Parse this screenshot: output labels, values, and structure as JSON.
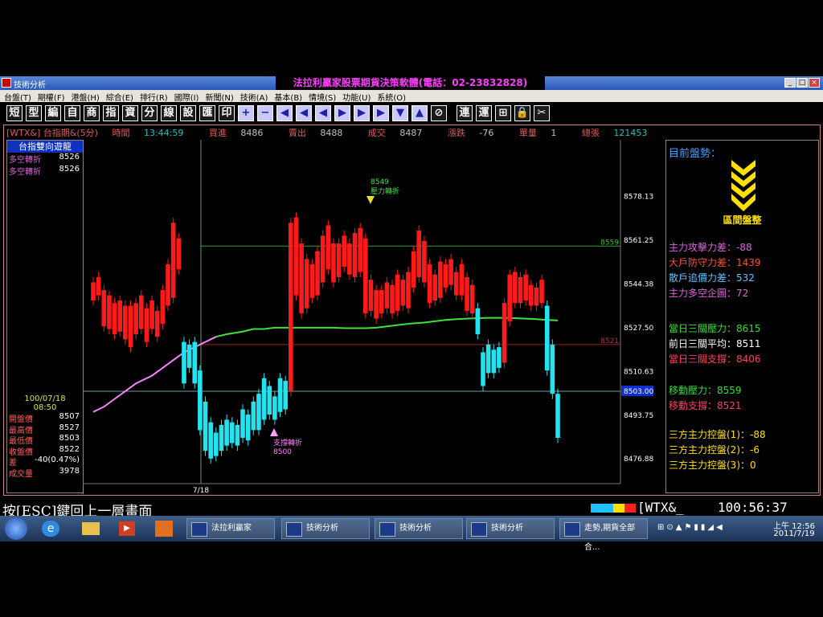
{
  "window": {
    "title": "技術分析",
    "center_title": "法拉利贏家股票期貨決策軟體(電話：02-23832828)"
  },
  "menu": [
    "台盤(T)",
    "期權(F)",
    "港盤(H)",
    "綜合(E)",
    "排行(R)",
    "國際(I)",
    "新聞(N)",
    "技術(A)",
    "基本(B)",
    "情境(S)",
    "功能(U)",
    "系統(O)"
  ],
  "toolbar": [
    "短",
    "型",
    "編",
    "自",
    "商",
    "指",
    "資",
    "分",
    "線",
    "設",
    "匯",
    "印",
    "+",
    "−",
    "◀",
    "◀",
    "◀",
    "▶",
    "▶",
    "▶",
    "▼",
    "▲",
    "⊘",
    "連",
    "運",
    "⊞",
    "🔒",
    "✂"
  ],
  "infobar": {
    "symbol": "[WTX&] 台指期&(5分)",
    "time_label": "時間",
    "time": "13:44:59",
    "bid_label": "買進",
    "bid": "8486",
    "ask_label": "賣出",
    "ask": "8488",
    "deal_label": "成交",
    "deal": "8487",
    "change_label": "漲跌",
    "change": "-76",
    "volume_label": "單量",
    "volume": "1",
    "total_label": "總張",
    "total": "121453"
  },
  "left_panel": {
    "header": "台指雙向遊龍",
    "rows": [
      {
        "label": "多空轉折",
        "value": "8526"
      },
      {
        "label": "多空轉折",
        "value": "8526"
      }
    ],
    "date": "100/07/18",
    "time": "08:50",
    "stats": [
      {
        "label": "開盤價",
        "value": "8507"
      },
      {
        "label": "最高價",
        "value": "8527"
      },
      {
        "label": "最低價",
        "value": "8503"
      },
      {
        "label": "收盤價",
        "value": "8522"
      },
      {
        "label": "差",
        "value": "-40(0.47%)"
      },
      {
        "label": "成交量",
        "value": "3978"
      }
    ]
  },
  "chart_data": {
    "type": "candlestick",
    "y_ticks": [
      "8578.13",
      "8561.25",
      "8544.38",
      "8527.50",
      "8510.63",
      "8503.00",
      "8493.75",
      "8476.88"
    ],
    "ylim": [
      8463,
      8600
    ],
    "x_tick": "7/18",
    "resistance_label": "8559",
    "support_label": "8521",
    "current_price": "8503.00",
    "annotations": [
      {
        "value": "8549",
        "text": "壓力轉折"
      },
      {
        "value": "8500",
        "text": "支撐轉折"
      }
    ],
    "candles": [
      [
        8543,
        8545,
        8540,
        8538
      ],
      [
        8544,
        8547,
        8540,
        8542
      ],
      [
        8542,
        8540,
        8530,
        8528
      ],
      [
        8538,
        8540,
        8528,
        8527
      ],
      [
        8535,
        8537,
        8526,
        8525
      ],
      [
        8536,
        8538,
        8527,
        8526
      ],
      [
        8533,
        8536,
        8524,
        8523
      ],
      [
        8531,
        8536,
        8521,
        8520
      ],
      [
        8535,
        8537,
        8526,
        8525
      ],
      [
        8538,
        8540,
        8528,
        8527
      ],
      [
        8532,
        8535,
        8524,
        8522
      ],
      [
        8536,
        8538,
        8528,
        8527
      ],
      [
        8532,
        8534,
        8525,
        8524
      ],
      [
        8540,
        8542,
        8530,
        8529
      ],
      [
        8550,
        8552,
        8538,
        8536
      ],
      [
        8560,
        8568,
        8540,
        8539
      ],
      [
        8558,
        8562,
        8551,
        8550
      ],
      [
        8520,
        8522,
        8508,
        8506
      ],
      [
        8516,
        8521,
        8513,
        8512
      ],
      [
        8519,
        8522,
        8507,
        8506
      ],
      [
        8508,
        8511,
        8490,
        8488
      ],
      [
        8497,
        8499,
        8484,
        8480
      ],
      [
        8488,
        8491,
        8480,
        8477
      ],
      [
        8485,
        8487,
        8480,
        8478
      ],
      [
        8488,
        8490,
        8482,
        8480
      ],
      [
        8490,
        8492,
        8484,
        8482
      ],
      [
        8488,
        8491,
        8485,
        8483
      ],
      [
        8487,
        8490,
        8484,
        8482
      ],
      [
        8493,
        8496,
        8487,
        8485
      ],
      [
        8492,
        8494,
        8486,
        8484
      ],
      [
        8496,
        8499,
        8490,
        8488
      ],
      [
        8500,
        8502,
        8490,
        8488
      ],
      [
        8505,
        8508,
        8494,
        8492
      ],
      [
        8503,
        8505,
        8495,
        8494
      ],
      [
        8499,
        8501,
        8493,
        8492
      ],
      [
        8504,
        8508,
        8496,
        8495
      ],
      [
        8505,
        8507,
        8497,
        8496
      ],
      [
        8506,
        8568,
        8504,
        8503
      ],
      [
        8566,
        8570,
        8545,
        8540
      ],
      [
        8545,
        8560,
        8535,
        8533
      ],
      [
        8545,
        8554,
        8537,
        8535
      ],
      [
        8548,
        8552,
        8540,
        8539
      ],
      [
        8551,
        8557,
        8541,
        8540
      ],
      [
        8560,
        8563,
        8546,
        8545
      ],
      [
        8564,
        8567,
        8552,
        8550
      ],
      [
        8554,
        8560,
        8547,
        8545
      ],
      [
        8555,
        8560,
        8549,
        8547
      ],
      [
        8560,
        8563,
        8552,
        8551
      ],
      [
        8558,
        8560,
        8549,
        8548
      ],
      [
        8560,
        8564,
        8548,
        8547
      ],
      [
        8564,
        8566,
        8551,
        8549
      ],
      [
        8549,
        8562,
        8535,
        8533
      ],
      [
        8540,
        8546,
        8536,
        8534
      ],
      [
        8538,
        8542,
        8533,
        8531
      ],
      [
        8540,
        8542,
        8535,
        8533
      ],
      [
        8543,
        8545,
        8537,
        8535
      ],
      [
        8541,
        8544,
        8535,
        8533
      ],
      [
        8545,
        8548,
        8536,
        8534
      ],
      [
        8544,
        8546,
        8538,
        8536
      ],
      [
        8546,
        8549,
        8537,
        8535
      ],
      [
        8554,
        8557,
        8545,
        8543
      ],
      [
        8563,
        8565,
        8549,
        8547
      ],
      [
        8555,
        8561,
        8547,
        8545
      ],
      [
        8547,
        8552,
        8538,
        8537
      ],
      [
        8545,
        8548,
        8539,
        8538
      ],
      [
        8547,
        8553,
        8541,
        8539
      ],
      [
        8550,
        8552,
        8545,
        8543
      ],
      [
        8552,
        8554,
        8545,
        8544
      ],
      [
        8546,
        8549,
        8541,
        8540
      ],
      [
        8549,
        8552,
        8542,
        8540
      ],
      [
        8541,
        8547,
        8536,
        8534
      ],
      [
        8540,
        8544,
        8534,
        8533
      ],
      [
        8533,
        8535,
        8525,
        8525
      ],
      [
        8515,
        8518,
        8505,
        8505
      ],
      [
        8516,
        8521,
        8512,
        8510
      ],
      [
        8513,
        8519,
        8511,
        8510
      ],
      [
        8518,
        8520,
        8514,
        8512
      ],
      [
        8535,
        8537,
        8515,
        8514
      ],
      [
        8545,
        8548,
        8532,
        8530
      ],
      [
        8546,
        8549,
        8538,
        8537
      ],
      [
        8544,
        8547,
        8538,
        8537
      ],
      [
        8545,
        8548,
        8539,
        8538
      ],
      [
        8542,
        8544,
        8537,
        8536
      ],
      [
        8540,
        8543,
        8537,
        8536
      ],
      [
        8544,
        8546,
        8538,
        8537
      ],
      [
        8533,
        8536,
        8512,
        8511
      ],
      [
        8518,
        8521,
        8503,
        8502
      ],
      [
        8500,
        8502,
        8486,
        8485
      ]
    ],
    "ma_line": [
      8495,
      8497,
      8500,
      8503,
      8506,
      8509,
      8512,
      8515,
      8518,
      8520,
      8522,
      8524,
      8525,
      8526,
      8527,
      8527,
      8527.5,
      8527.5,
      8527.5,
      8527.5,
      8527.5,
      8527.5,
      8527.3,
      8527.3,
      8527.3,
      8527.5,
      8528,
      8528.5,
      8529,
      8529.5,
      8530,
      8530.5,
      8530.8,
      8531,
      8531.2,
      8531.3,
      8531.3,
      8531.2,
      8531,
      8530.8,
      8530.5,
      8530.3
    ]
  },
  "right_panel": {
    "current": "目前盤勢：",
    "trend": "區間盤整",
    "lines1": [
      {
        "text": "主力攻擊力差：-88",
        "color": "#e060e0"
      },
      {
        "text": "大戶防守力差：1439",
        "color": "#ff5030"
      },
      {
        "text": "散戶追價力差：532",
        "color": "#60c0ff"
      },
      {
        "text": "主力多空企圖：72",
        "color": "#e060e0"
      }
    ],
    "lines2": [
      {
        "text": "當日三關壓力：8615",
        "color": "#30e030"
      },
      {
        "text": "前日三關平均：8511",
        "color": "#ffffff"
      },
      {
        "text": "當日三關支撐：8406",
        "color": "#ff4060"
      }
    ],
    "lines3": [
      {
        "text": "移動壓力：8559",
        "color": "#30e030"
      },
      {
        "text": "移動支撐：8521",
        "color": "#ff4060"
      }
    ],
    "lines4": [
      {
        "text": "三方主力控盤(1)：-88",
        "color": "#ffe000"
      },
      {
        "text": "三方主力控盤(2)：-6",
        "color": "#ffe000"
      },
      {
        "text": "三方主力控盤(3)：0",
        "color": "#ffe000"
      }
    ]
  },
  "status": {
    "hint": "按[ESC]鍵回上一層畫面",
    "symbol": "[WTX&_",
    "clock": "100:56:37"
  },
  "taskbar": {
    "tasks": [
      "法拉利贏家",
      "技術分析",
      "技術分析",
      "技術分析",
      "走勢,期貨全部合..."
    ],
    "time": "上午 12:56",
    "date": "2011/7/19"
  },
  "colors": {
    "up": "#ff1a1a",
    "down": "#22e4f0",
    "ma_pink": "#ff80ff",
    "ma_green": "#40e040",
    "panel_border": "#d08080"
  }
}
